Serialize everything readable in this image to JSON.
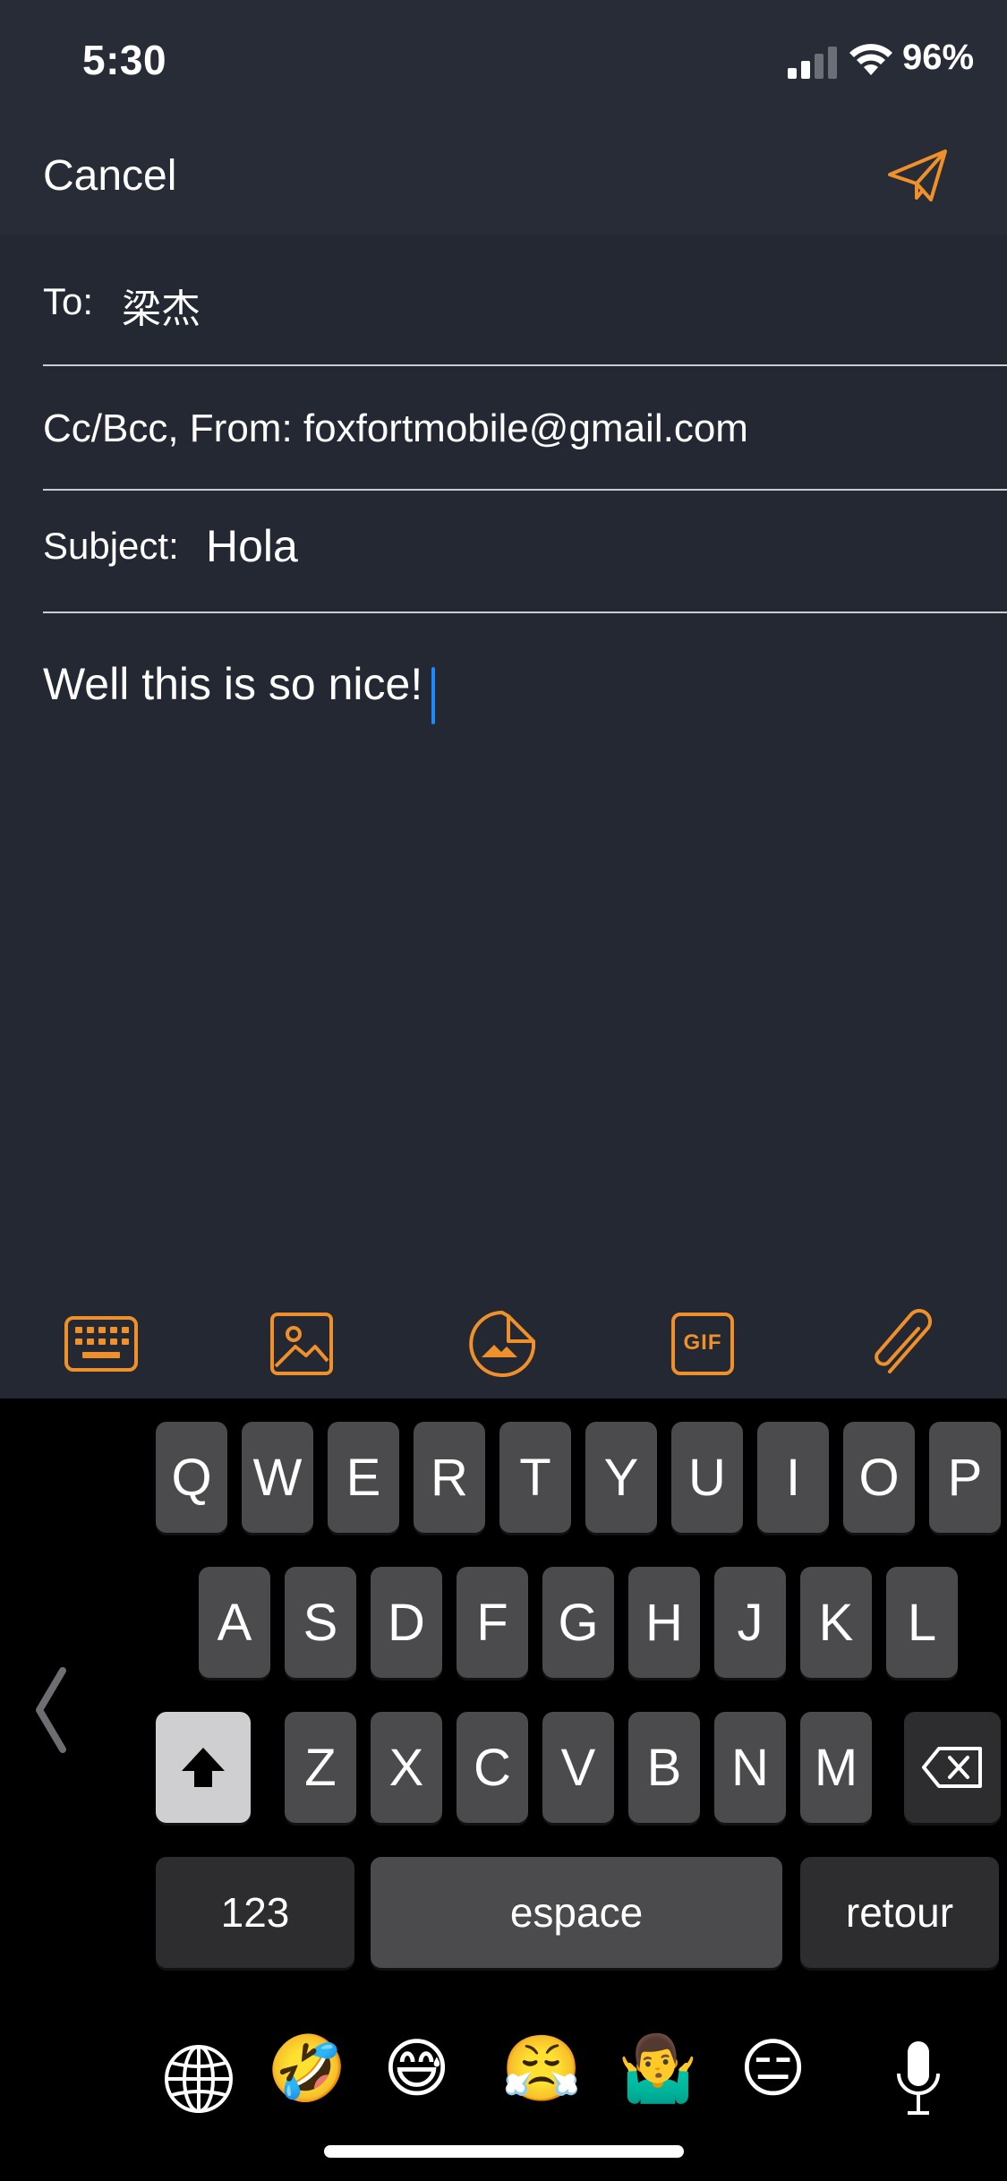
{
  "status": {
    "time": "5:30",
    "battery": "96%"
  },
  "nav": {
    "cancel_label": "Cancel",
    "send_icon": "paper-plane-icon"
  },
  "compose": {
    "to_label": "To:",
    "to_value": "梁杰",
    "cc_from": "Cc/Bcc, From: foxfortmobile@gmail.com",
    "subject_label": "Subject:",
    "subject_value": "Hola",
    "body": "Well this is so nice!"
  },
  "toolbar": {
    "items": [
      "keyboard-icon",
      "image-icon",
      "sticker-icon",
      "gif-icon",
      "paperclip-icon"
    ],
    "gif_text": "GIF"
  },
  "keyboard": {
    "row1": [
      "Q",
      "W",
      "E",
      "R",
      "T",
      "Y",
      "U",
      "I",
      "O",
      "P"
    ],
    "row2": [
      "A",
      "S",
      "D",
      "F",
      "G",
      "H",
      "J",
      "K",
      "L"
    ],
    "row3": [
      "Z",
      "X",
      "C",
      "V",
      "B",
      "N",
      "M"
    ],
    "numbers_label": "123",
    "space_label": "espace",
    "return_label": "retour",
    "emojis": [
      "🤣",
      "😅",
      "😤",
      "🤷‍♂️",
      "😑"
    ]
  },
  "colors": {
    "accent": "#f0902a",
    "background": "#232833",
    "header": "#272c37",
    "key": "#4b4b4d",
    "key_dark": "#2d2d2f",
    "caret": "#1e88ff"
  }
}
